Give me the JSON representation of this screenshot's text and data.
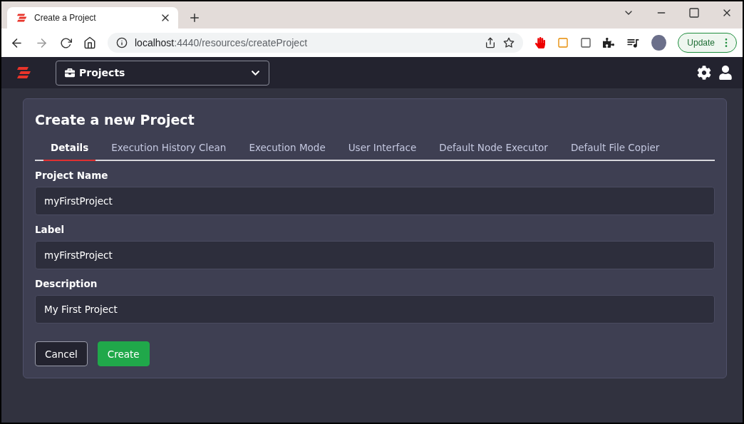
{
  "browser": {
    "tab_title": "Create a Project",
    "url_host": "localhost",
    "url_rest": ":4440/resources/createProject",
    "update_label": "Update"
  },
  "nav": {
    "project_menu": "Projects"
  },
  "card": {
    "title": "Create a new Project",
    "tabs": [
      {
        "label": "Details",
        "selected": true
      },
      {
        "label": "Execution History Clean",
        "selected": false
      },
      {
        "label": "Execution Mode",
        "selected": false
      },
      {
        "label": "User Interface",
        "selected": false
      },
      {
        "label": "Default Node Executor",
        "selected": false
      },
      {
        "label": "Default File Copier",
        "selected": false
      }
    ],
    "fields": [
      {
        "label": "Project Name",
        "value": "myFirstProject"
      },
      {
        "label": "Label",
        "value": "myFirstProject"
      },
      {
        "label": "Description",
        "value": "My First Project"
      }
    ],
    "buttons": [
      {
        "label": "Cancel",
        "kind": "secondary"
      },
      {
        "label": "Create",
        "kind": "primary"
      }
    ]
  }
}
